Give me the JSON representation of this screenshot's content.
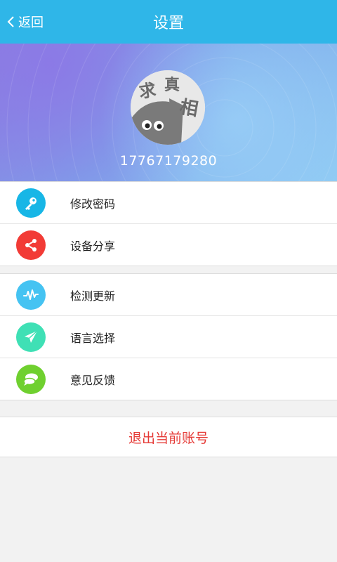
{
  "header": {
    "back_label": "返回",
    "title": "设置",
    "bg_color": "#2fb6e8"
  },
  "profile": {
    "avatar_text": [
      "求",
      "真",
      "相"
    ],
    "phone": "17767179280"
  },
  "group1": {
    "items": [
      {
        "label": "修改密码",
        "icon": "key-icon",
        "color": "#17b6e6"
      },
      {
        "label": "设备分享",
        "icon": "share-icon",
        "color": "#f23b36"
      }
    ]
  },
  "group2": {
    "items": [
      {
        "label": "检测更新",
        "icon": "pulse-icon",
        "color": "#45c3f2"
      },
      {
        "label": "语言选择",
        "icon": "paper-plane-icon",
        "color": "#3fe0b5"
      },
      {
        "label": "意见反馈",
        "icon": "chat-bubbles-icon",
        "color": "#6fd02f"
      }
    ]
  },
  "logout": {
    "label": "退出当前账号",
    "color": "#e53935"
  }
}
